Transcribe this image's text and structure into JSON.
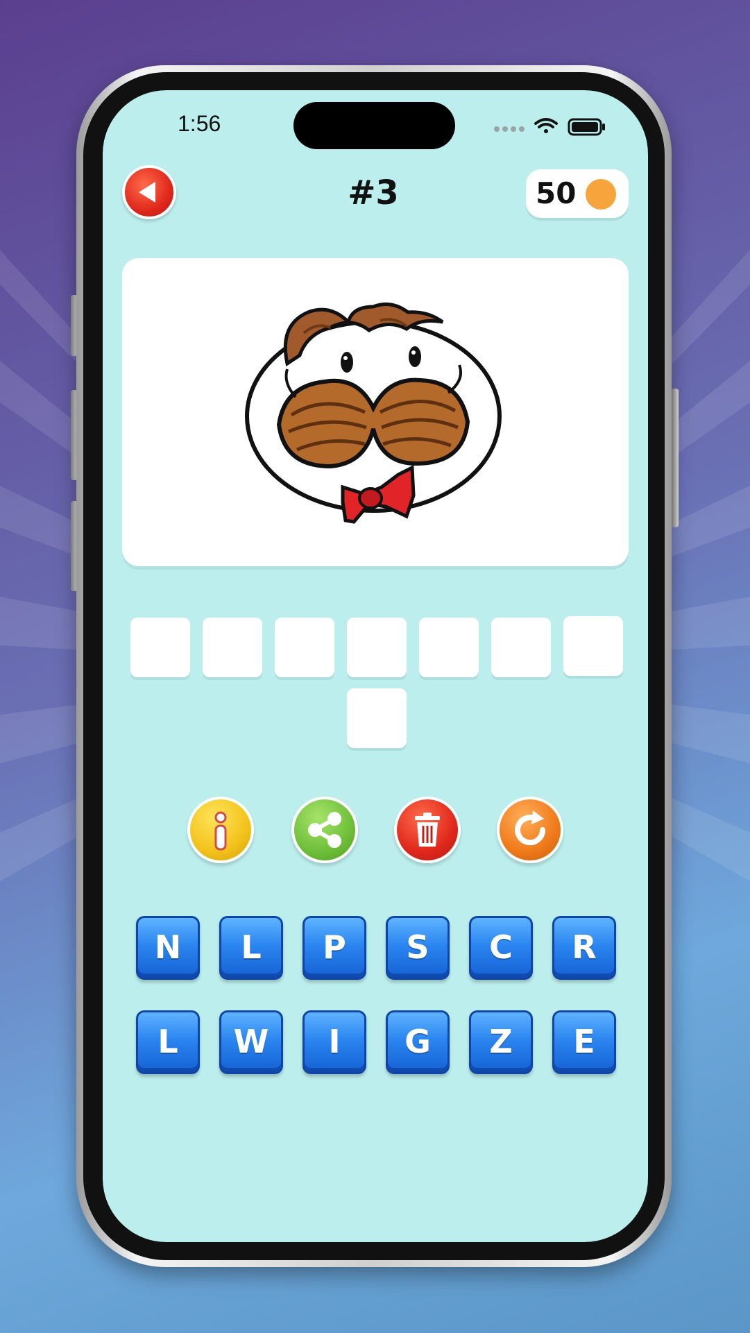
{
  "status_bar": {
    "time": "1:56",
    "icons": [
      "signal-dots-icon",
      "wifi-icon",
      "battery-icon"
    ]
  },
  "header": {
    "back_icon": "back-arrow-icon",
    "level": "#3",
    "coins": "50",
    "coin_icon": "coin-icon"
  },
  "puzzle": {
    "image_icon": "mustache-mascot-logo",
    "answer_slots": [
      "",
      "",
      "",
      "",
      "",
      "",
      "",
      ""
    ]
  },
  "actions": [
    {
      "name": "hint-button",
      "icon": "info-icon",
      "color": "#f2c21b"
    },
    {
      "name": "share-button",
      "icon": "share-icon",
      "color": "#6fbf3a"
    },
    {
      "name": "delete-button",
      "icon": "trash-icon",
      "color": "#e0281c"
    },
    {
      "name": "reset-button",
      "icon": "refresh-icon",
      "color": "#ef7a1a"
    }
  ],
  "keyboard": {
    "row1": [
      "N",
      "L",
      "P",
      "S",
      "C",
      "R"
    ],
    "row2": [
      "L",
      "W",
      "I",
      "G",
      "Z",
      "E"
    ]
  },
  "colors": {
    "screen_bg": "#bbeeed",
    "key_blue": "#2b86f0",
    "coin_orange": "#f6a43b"
  }
}
